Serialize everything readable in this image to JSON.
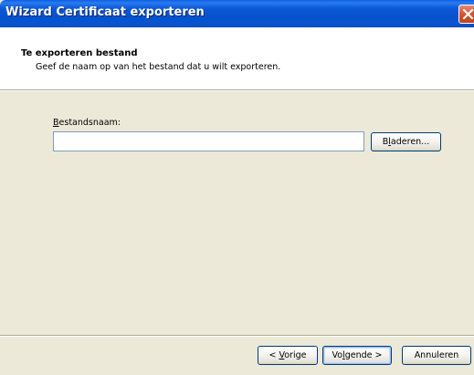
{
  "window": {
    "title": "Wizard Certificaat exporteren"
  },
  "header": {
    "title": "Te exporteren bestand",
    "subtitle": "Geef de naam op van het bestand dat u wilt exporteren."
  },
  "form": {
    "filename_label_mnemonic": "B",
    "filename_label_rest": "estandsnaam:",
    "filename_value": "",
    "browse_mnemonic": "B",
    "browse_middle": "l",
    "browse_rest": "aderen..."
  },
  "footer": {
    "back_prefix": "< ",
    "back_mnemonic": "V",
    "back_rest": "orige",
    "next_pre": "Vo",
    "next_mnemonic": "l",
    "next_rest": "gende >",
    "cancel_label": "Annuleren"
  },
  "colors": {
    "titlebar": "#0A58D8",
    "dialog_background": "#ECE9D8",
    "close_button": "#D5532F"
  }
}
